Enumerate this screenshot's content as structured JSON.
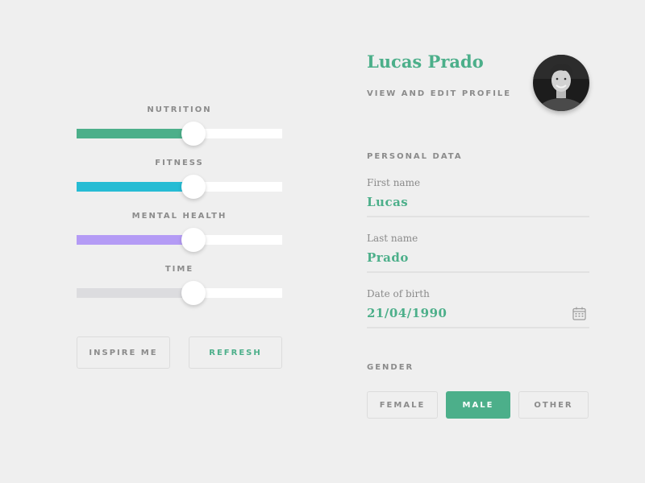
{
  "colors": {
    "accent_green": "#4caf8a",
    "fitness_cyan": "#26bcd4",
    "mental_purple": "#b49bf5",
    "time_gray": "#dcdcdf",
    "muted_text": "#8b8b8b"
  },
  "sliders": [
    {
      "label": "NUTRITION",
      "value_fraction": 0.57,
      "color": "#4caf8a"
    },
    {
      "label": "FITNESS",
      "value_fraction": 0.57,
      "color": "#26bcd4"
    },
    {
      "label": "MENTAL HEALTH",
      "value_fraction": 0.57,
      "color": "#b49bf5"
    },
    {
      "label": "TIME",
      "value_fraction": 0.57,
      "color": "#dcdcdf"
    }
  ],
  "actions": {
    "inspire_label": "INSPIRE ME",
    "refresh_label": "REFRESH"
  },
  "profile": {
    "name": "Lucas Prado",
    "view_edit_label": "VIEW AND EDIT PROFILE",
    "avatar_icon": "user-avatar-photo"
  },
  "personal_data": {
    "heading": "PERSONAL DATA",
    "first_name": {
      "label": "First name",
      "value": "Lucas"
    },
    "last_name": {
      "label": "Last name",
      "value": "Prado"
    },
    "dob": {
      "label": "Date of birth",
      "value": "21/04/1990",
      "icon": "calendar-icon"
    }
  },
  "gender": {
    "heading": "GENDER",
    "options": [
      "FEMALE",
      "MALE",
      "OTHER"
    ],
    "selected": "MALE"
  }
}
